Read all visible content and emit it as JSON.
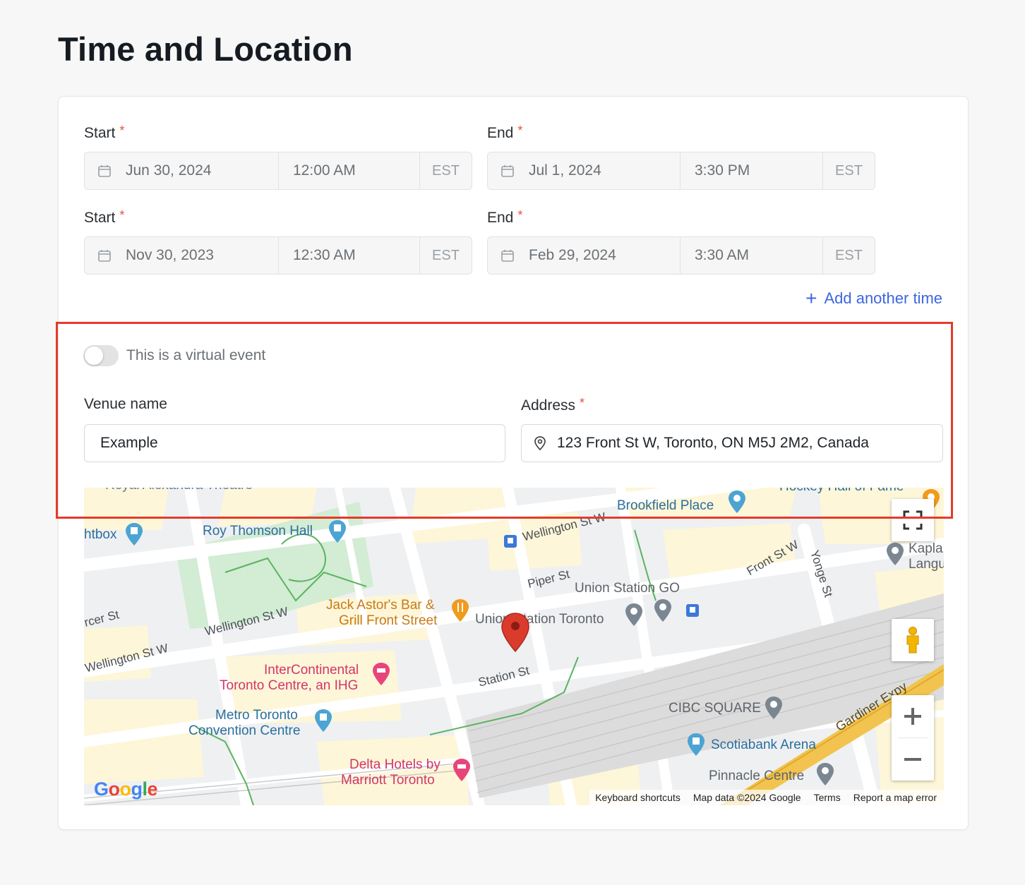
{
  "page": {
    "title": "Time and Location"
  },
  "times": [
    {
      "start": {
        "label": "Start",
        "date": "Jun 30, 2024",
        "time": "12:00 AM",
        "tz": "EST"
      },
      "end": {
        "label": "End",
        "date": "Jul 1, 2024",
        "time": "3:30 PM",
        "tz": "EST"
      }
    },
    {
      "start": {
        "label": "Start",
        "date": "Nov 30, 2023",
        "time": "12:30 AM",
        "tz": "EST"
      },
      "end": {
        "label": "End",
        "date": "Feb 29, 2024",
        "time": "3:30 AM",
        "tz": "EST"
      }
    }
  ],
  "required_mark": "*",
  "add_time": {
    "icon": "+",
    "label": "Add another time"
  },
  "virtual_toggle": {
    "label": "This is a virtual event",
    "on": false
  },
  "venue": {
    "label": "Venue name",
    "value": "Example"
  },
  "address": {
    "label": "Address",
    "value": "123 Front St W, Toronto, ON M5J 2M2, Canada",
    "icon": "location-pin-icon"
  },
  "map": {
    "labels": {
      "royal_alex": "Royal Alexandra Theatre",
      "lightbox": "htbox",
      "roy_thomson": "Roy Thomson Hall",
      "wellington_top": "Wellington St W",
      "brookfield": "Brookfield Place",
      "hockey": "Hockey Hall of Fame",
      "kaplan1": "Kapla",
      "kaplan2": "Langu",
      "piper": "Piper St",
      "union_go": "Union Station GO",
      "front": "Front St W",
      "yonge": "Yonge St",
      "mercer": "rcer St",
      "wellington_mid": "Wellington St W",
      "wellington_left": "Wellington St W",
      "jack1": "Jack Astor's Bar &",
      "jack2": "Grill Front Street",
      "union": "Union Station Toronto",
      "interc1": "InterContinental",
      "interc2": "Toronto Centre, an IHG",
      "station": "Station St",
      "metro1": "Metro Toronto",
      "metro2": "Convention Centre",
      "cibc": "CIBC SQUARE",
      "scotiabank": "Scotiabank Arena",
      "gardiner": "Gardiner Expy",
      "delta1": "Delta Hotels by",
      "delta2": "Marriott Toronto",
      "pinnacle": "Pinnacle Centre",
      "google": "Google"
    },
    "attribution": {
      "shortcuts": "Keyboard shortcuts",
      "data": "Map data ©2024 Google",
      "terms": "Terms",
      "report": "Report a map error"
    },
    "colors": {
      "park": "#d3ecd4",
      "block": "#fdf6d8",
      "road": "#ffffff",
      "highway": "#f2c44f",
      "rail": "#d6d6d6",
      "marker": "#db3b2c"
    }
  }
}
